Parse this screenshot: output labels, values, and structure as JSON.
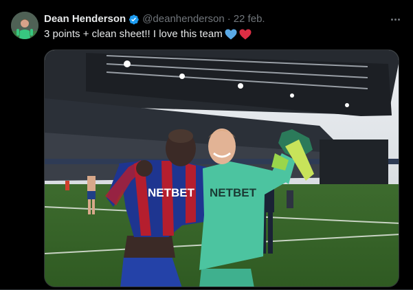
{
  "tweet": {
    "author_name": "Dean Henderson",
    "handle": "@deanhenderson",
    "separator": "·",
    "date": "22 feb.",
    "text": "3 points + clean sheet!! I love this team",
    "emojis": [
      "blue-heart",
      "red-heart"
    ],
    "verified_color": "#1d9bf0"
  },
  "media": {
    "shirt_sponsor_left": "NETBET",
    "shirt_sponsor_right": "NETBET"
  },
  "colors": {
    "background": "#000000",
    "text": "#e7e9ea",
    "muted": "#71767b",
    "accent": "#1d9bf0",
    "heart_blue": "#5aa9e6",
    "heart_red": "#dd2e44"
  }
}
